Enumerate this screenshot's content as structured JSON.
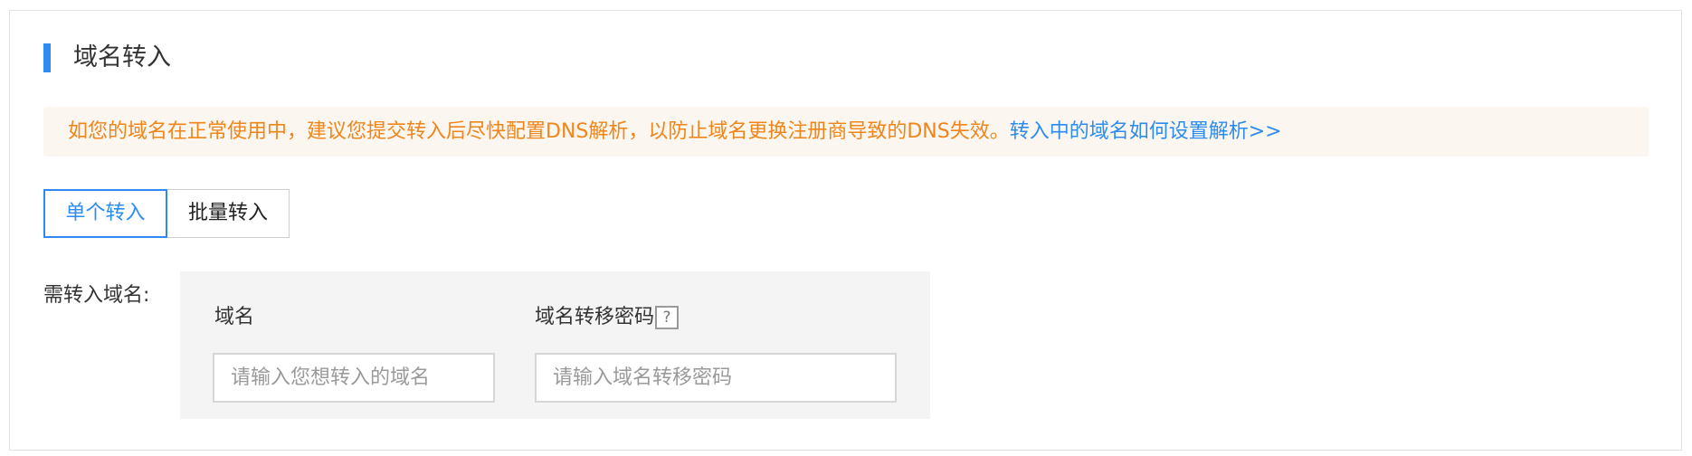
{
  "section": {
    "title": "域名转入"
  },
  "notice": {
    "warning_text": "如您的域名在正常使用中，建议您提交转入后尽快配置DNS解析，以防止域名更换注册商导致的DNS失效。",
    "link_text": "转入中的域名如何设置解析>>"
  },
  "tabs": [
    {
      "label": "单个转入",
      "active": true
    },
    {
      "label": "批量转入",
      "active": false
    }
  ],
  "form": {
    "label": "需转入域名:",
    "columns": {
      "domain": "域名",
      "transfer_code": "域名转移密码"
    },
    "help_icon": "?",
    "inputs": {
      "domain_placeholder": "请输入您想转入的域名",
      "domain_value": "",
      "code_placeholder": "请输入域名转移密码",
      "code_value": ""
    }
  },
  "colors": {
    "accent": "#2d8cf0",
    "warning": "#f08519",
    "notice_bg": "#fcf6f0",
    "form_bg": "#f4f4f4"
  }
}
